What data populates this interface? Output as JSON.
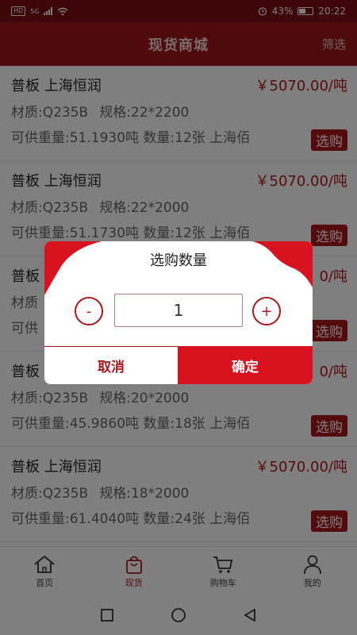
{
  "status_bar": {
    "hd": "HD",
    "network": "5G",
    "battery": "43%",
    "time": "20:22"
  },
  "header": {
    "title": "现货商城",
    "filter_label": "筛选"
  },
  "products": [
    {
      "name": "普板 上海恒润",
      "price": "￥5070.00/吨",
      "material": "材质:Q235B",
      "spec": "规格:22*2200",
      "supply": "可供重量:51.1930吨 数量:12张 上海佰",
      "buy_label": "选购"
    },
    {
      "name": "普板 上海恒润",
      "price": "￥5070.00/吨",
      "material": "材质:Q235B",
      "spec": "规格:22*2000",
      "supply": "可供重量:51.1730吨 数量:12张 上海佰",
      "buy_label": "选购"
    },
    {
      "name": "普板",
      "price": "0/吨",
      "material": "材质",
      "spec": "",
      "supply": "可供",
      "buy_label": "选购"
    },
    {
      "name": "普板",
      "price": "0/吨",
      "material": "材质:Q235B",
      "spec": "规格:20*2000",
      "supply": "可供重量:45.9860吨 数量:18张 上海佰",
      "buy_label": "选购"
    },
    {
      "name": "普板 上海恒润",
      "price": "￥5070.00/吨",
      "material": "材质:Q235B",
      "spec": "规格:18*2000",
      "supply": "可供重量:61.4040吨 数量:24张 上海佰",
      "buy_label": "选购"
    }
  ],
  "tabs": [
    {
      "label": "首页",
      "icon": "home-icon"
    },
    {
      "label": "现货",
      "icon": "bag-icon"
    },
    {
      "label": "购物车",
      "icon": "cart-icon"
    },
    {
      "label": "我的",
      "icon": "user-icon"
    }
  ],
  "dialog": {
    "title": "选购数量",
    "minus": "-",
    "plus": "+",
    "quantity": "1",
    "cancel_label": "取消",
    "confirm_label": "确定"
  },
  "colors": {
    "brand": "#9c1519",
    "accent": "#d8121e",
    "price": "#b0161c"
  }
}
